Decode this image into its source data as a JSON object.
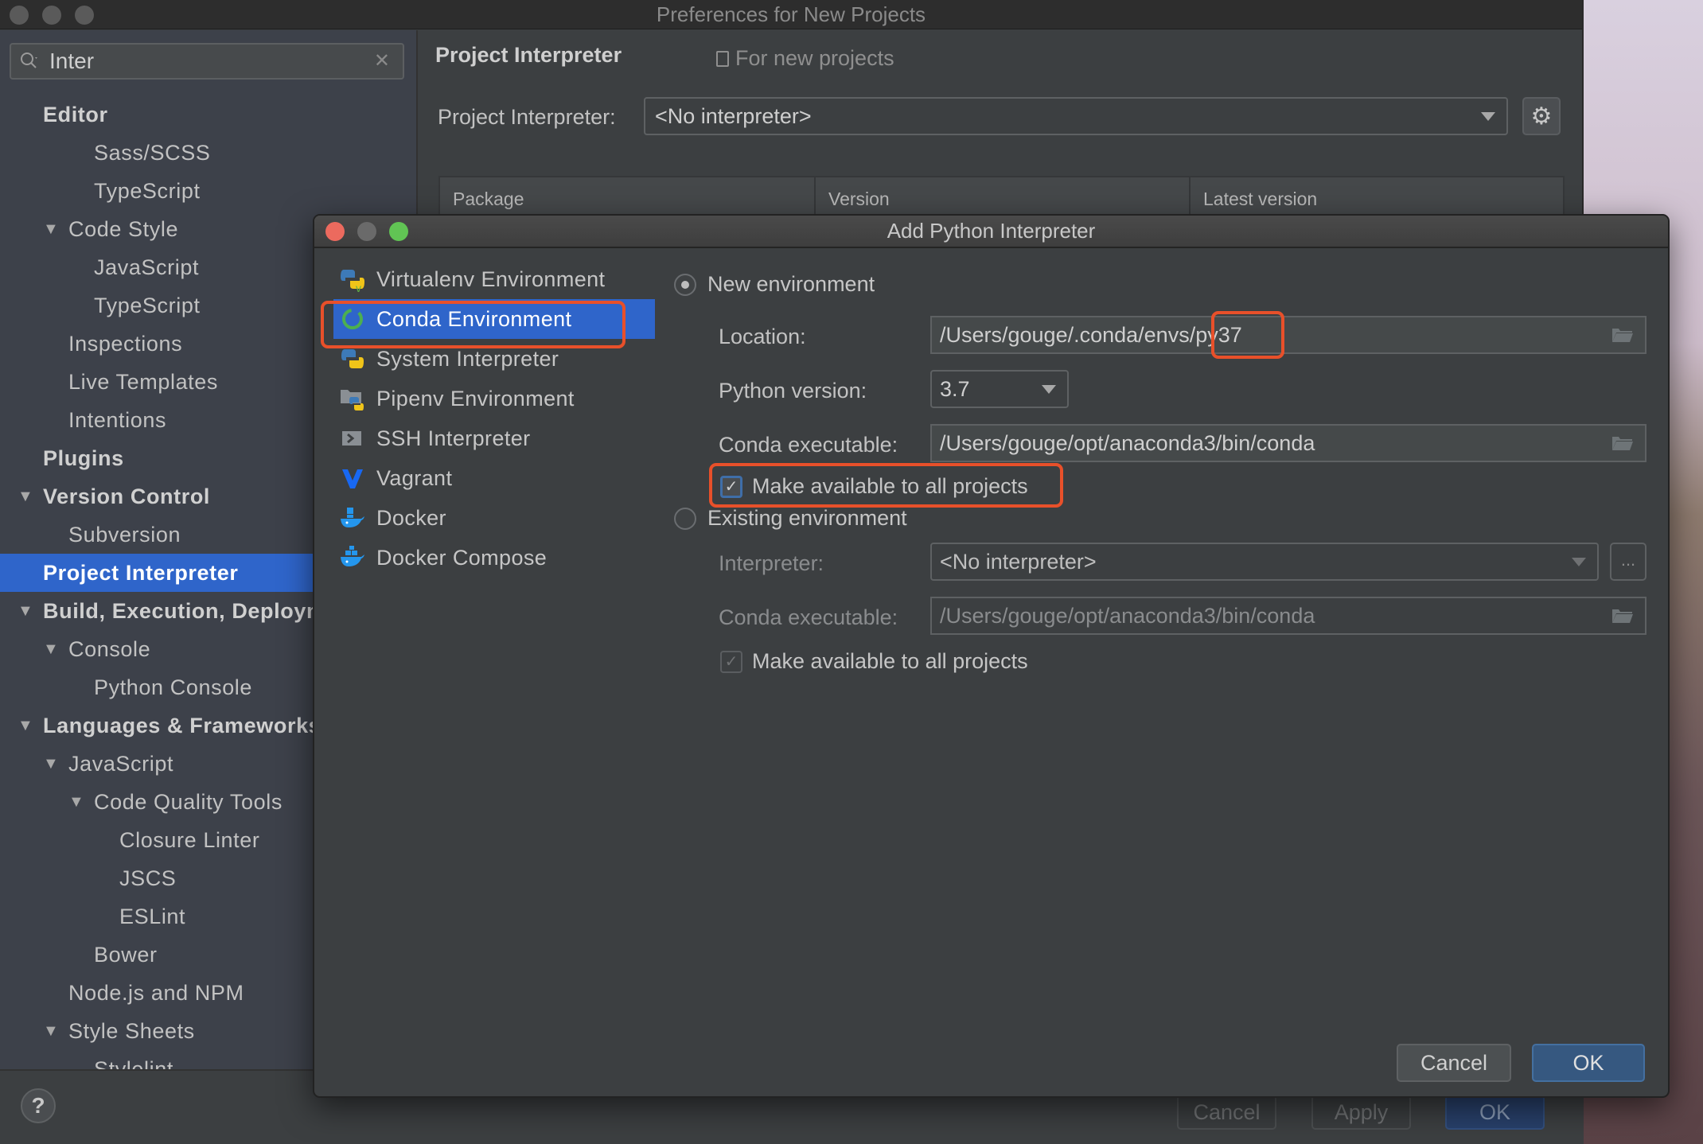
{
  "main_window": {
    "title": "Preferences for New Projects",
    "search": {
      "value": "Inter",
      "placeholder": ""
    },
    "tree": [
      {
        "label": "Editor",
        "level": 0,
        "bold": true,
        "arrow": false
      },
      {
        "label": "Sass/SCSS",
        "level": 2,
        "bold": false,
        "arrow": false
      },
      {
        "label": "TypeScript",
        "level": 2,
        "bold": false,
        "arrow": false
      },
      {
        "label": "Code Style",
        "level": 1,
        "bold": false,
        "arrow": true
      },
      {
        "label": "JavaScript",
        "level": 2,
        "bold": false,
        "arrow": false
      },
      {
        "label": "TypeScript",
        "level": 2,
        "bold": false,
        "arrow": false
      },
      {
        "label": "Inspections",
        "level": 1,
        "bold": false,
        "arrow": false
      },
      {
        "label": "Live Templates",
        "level": 1,
        "bold": false,
        "arrow": false
      },
      {
        "label": "Intentions",
        "level": 1,
        "bold": false,
        "arrow": false
      },
      {
        "label": "Plugins",
        "level": 0,
        "bold": true,
        "arrow": false
      },
      {
        "label": "Version Control",
        "level": 0,
        "bold": true,
        "arrow": true
      },
      {
        "label": "Subversion",
        "level": 1,
        "bold": false,
        "arrow": false
      },
      {
        "label": "Project Interpreter",
        "level": 0,
        "bold": true,
        "arrow": false,
        "selected": true
      },
      {
        "label": "Build, Execution, Deployment",
        "level": 0,
        "bold": true,
        "arrow": true
      },
      {
        "label": "Console",
        "level": 1,
        "bold": false,
        "arrow": true
      },
      {
        "label": "Python Console",
        "level": 2,
        "bold": false,
        "arrow": false
      },
      {
        "label": "Languages & Frameworks",
        "level": 0,
        "bold": true,
        "arrow": true
      },
      {
        "label": "JavaScript",
        "level": 1,
        "bold": false,
        "arrow": true
      },
      {
        "label": "Code Quality Tools",
        "level": 2,
        "bold": false,
        "arrow": true
      },
      {
        "label": "Closure Linter",
        "level": 3,
        "bold": false,
        "arrow": false
      },
      {
        "label": "JSCS",
        "level": 3,
        "bold": false,
        "arrow": false
      },
      {
        "label": "ESLint",
        "level": 3,
        "bold": false,
        "arrow": false
      },
      {
        "label": "Bower",
        "level": 2,
        "bold": false,
        "arrow": false
      },
      {
        "label": "Node.js and NPM",
        "level": 1,
        "bold": false,
        "arrow": false
      },
      {
        "label": "Style Sheets",
        "level": 1,
        "bold": false,
        "arrow": true
      },
      {
        "label": "Stylelint",
        "level": 2,
        "bold": false,
        "arrow": false
      }
    ],
    "content": {
      "title": "Project Interpreter",
      "scope_note": "For new projects",
      "interpreter_label": "Project Interpreter:",
      "interpreter_value": "<No interpreter>",
      "table_headers": [
        "Package",
        "Version",
        "Latest version"
      ]
    },
    "buttons": {
      "help": "?",
      "cancel": "Cancel",
      "apply": "Apply",
      "ok": "OK"
    }
  },
  "dialog": {
    "title": "Add Python Interpreter",
    "env_types": [
      {
        "label": "Virtualenv Environment",
        "icon": "python-virtualenv-icon"
      },
      {
        "label": "Conda Environment",
        "icon": "conda-icon",
        "selected": true
      },
      {
        "label": "System Interpreter",
        "icon": "python-icon"
      },
      {
        "label": "Pipenv Environment",
        "icon": "pipenv-folder-icon"
      },
      {
        "label": "SSH Interpreter",
        "icon": "ssh-terminal-icon"
      },
      {
        "label": "Vagrant",
        "icon": "vagrant-icon"
      },
      {
        "label": "Docker",
        "icon": "docker-icon"
      },
      {
        "label": "Docker Compose",
        "icon": "docker-compose-icon"
      }
    ],
    "new_env": {
      "radio_label": "New environment",
      "selected": true,
      "location_label": "Location:",
      "location_prefix": "/Users/gouge/.conda/envs/",
      "location_name": "py37",
      "python_version_label": "Python version:",
      "python_version": "3.7",
      "conda_exec_label": "Conda executable:",
      "conda_exec": "/Users/gouge/opt/anaconda3/bin/conda",
      "make_available_label": "Make available to all projects",
      "make_available_checked": true
    },
    "existing_env": {
      "radio_label": "Existing environment",
      "selected": false,
      "interpreter_label": "Interpreter:",
      "interpreter_value": "<No interpreter>",
      "browse_label": "...",
      "conda_exec_label": "Conda executable:",
      "conda_exec": "/Users/gouge/opt/anaconda3/bin/conda",
      "make_available_label": "Make available to all projects",
      "make_available_checked": true
    },
    "buttons": {
      "cancel": "Cancel",
      "ok": "OK"
    },
    "highlight_color": "#e8502a",
    "selection_color": "#2f65ca"
  }
}
